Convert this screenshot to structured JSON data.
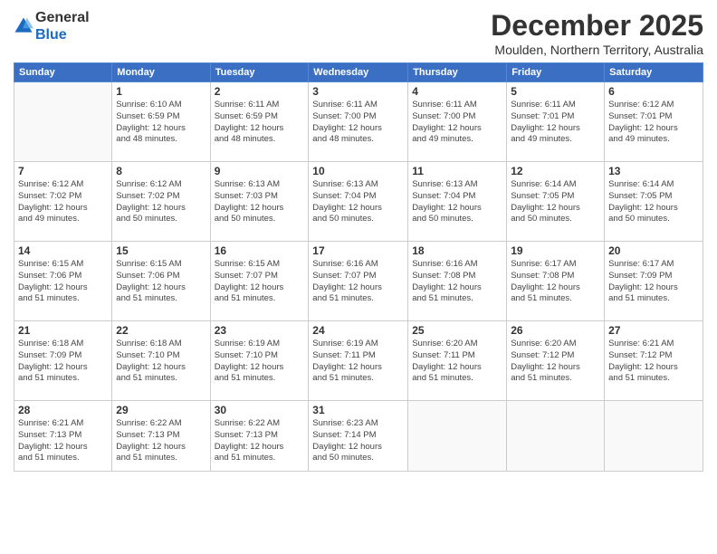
{
  "header": {
    "logo_line1": "General",
    "logo_line2": "Blue",
    "month": "December 2025",
    "location": "Moulden, Northern Territory, Australia"
  },
  "days_of_week": [
    "Sunday",
    "Monday",
    "Tuesday",
    "Wednesday",
    "Thursday",
    "Friday",
    "Saturday"
  ],
  "weeks": [
    [
      {
        "day": "",
        "detail": ""
      },
      {
        "day": "1",
        "detail": "Sunrise: 6:10 AM\nSunset: 6:59 PM\nDaylight: 12 hours\nand 48 minutes."
      },
      {
        "day": "2",
        "detail": "Sunrise: 6:11 AM\nSunset: 6:59 PM\nDaylight: 12 hours\nand 48 minutes."
      },
      {
        "day": "3",
        "detail": "Sunrise: 6:11 AM\nSunset: 7:00 PM\nDaylight: 12 hours\nand 48 minutes."
      },
      {
        "day": "4",
        "detail": "Sunrise: 6:11 AM\nSunset: 7:00 PM\nDaylight: 12 hours\nand 49 minutes."
      },
      {
        "day": "5",
        "detail": "Sunrise: 6:11 AM\nSunset: 7:01 PM\nDaylight: 12 hours\nand 49 minutes."
      },
      {
        "day": "6",
        "detail": "Sunrise: 6:12 AM\nSunset: 7:01 PM\nDaylight: 12 hours\nand 49 minutes."
      }
    ],
    [
      {
        "day": "7",
        "detail": "Sunrise: 6:12 AM\nSunset: 7:02 PM\nDaylight: 12 hours\nand 49 minutes."
      },
      {
        "day": "8",
        "detail": "Sunrise: 6:12 AM\nSunset: 7:02 PM\nDaylight: 12 hours\nand 50 minutes."
      },
      {
        "day": "9",
        "detail": "Sunrise: 6:13 AM\nSunset: 7:03 PM\nDaylight: 12 hours\nand 50 minutes."
      },
      {
        "day": "10",
        "detail": "Sunrise: 6:13 AM\nSunset: 7:04 PM\nDaylight: 12 hours\nand 50 minutes."
      },
      {
        "day": "11",
        "detail": "Sunrise: 6:13 AM\nSunset: 7:04 PM\nDaylight: 12 hours\nand 50 minutes."
      },
      {
        "day": "12",
        "detail": "Sunrise: 6:14 AM\nSunset: 7:05 PM\nDaylight: 12 hours\nand 50 minutes."
      },
      {
        "day": "13",
        "detail": "Sunrise: 6:14 AM\nSunset: 7:05 PM\nDaylight: 12 hours\nand 50 minutes."
      }
    ],
    [
      {
        "day": "14",
        "detail": "Sunrise: 6:15 AM\nSunset: 7:06 PM\nDaylight: 12 hours\nand 51 minutes."
      },
      {
        "day": "15",
        "detail": "Sunrise: 6:15 AM\nSunset: 7:06 PM\nDaylight: 12 hours\nand 51 minutes."
      },
      {
        "day": "16",
        "detail": "Sunrise: 6:15 AM\nSunset: 7:07 PM\nDaylight: 12 hours\nand 51 minutes."
      },
      {
        "day": "17",
        "detail": "Sunrise: 6:16 AM\nSunset: 7:07 PM\nDaylight: 12 hours\nand 51 minutes."
      },
      {
        "day": "18",
        "detail": "Sunrise: 6:16 AM\nSunset: 7:08 PM\nDaylight: 12 hours\nand 51 minutes."
      },
      {
        "day": "19",
        "detail": "Sunrise: 6:17 AM\nSunset: 7:08 PM\nDaylight: 12 hours\nand 51 minutes."
      },
      {
        "day": "20",
        "detail": "Sunrise: 6:17 AM\nSunset: 7:09 PM\nDaylight: 12 hours\nand 51 minutes."
      }
    ],
    [
      {
        "day": "21",
        "detail": "Sunrise: 6:18 AM\nSunset: 7:09 PM\nDaylight: 12 hours\nand 51 minutes."
      },
      {
        "day": "22",
        "detail": "Sunrise: 6:18 AM\nSunset: 7:10 PM\nDaylight: 12 hours\nand 51 minutes."
      },
      {
        "day": "23",
        "detail": "Sunrise: 6:19 AM\nSunset: 7:10 PM\nDaylight: 12 hours\nand 51 minutes."
      },
      {
        "day": "24",
        "detail": "Sunrise: 6:19 AM\nSunset: 7:11 PM\nDaylight: 12 hours\nand 51 minutes."
      },
      {
        "day": "25",
        "detail": "Sunrise: 6:20 AM\nSunset: 7:11 PM\nDaylight: 12 hours\nand 51 minutes."
      },
      {
        "day": "26",
        "detail": "Sunrise: 6:20 AM\nSunset: 7:12 PM\nDaylight: 12 hours\nand 51 minutes."
      },
      {
        "day": "27",
        "detail": "Sunrise: 6:21 AM\nSunset: 7:12 PM\nDaylight: 12 hours\nand 51 minutes."
      }
    ],
    [
      {
        "day": "28",
        "detail": "Sunrise: 6:21 AM\nSunset: 7:13 PM\nDaylight: 12 hours\nand 51 minutes."
      },
      {
        "day": "29",
        "detail": "Sunrise: 6:22 AM\nSunset: 7:13 PM\nDaylight: 12 hours\nand 51 minutes."
      },
      {
        "day": "30",
        "detail": "Sunrise: 6:22 AM\nSunset: 7:13 PM\nDaylight: 12 hours\nand 51 minutes."
      },
      {
        "day": "31",
        "detail": "Sunrise: 6:23 AM\nSunset: 7:14 PM\nDaylight: 12 hours\nand 50 minutes."
      },
      {
        "day": "",
        "detail": ""
      },
      {
        "day": "",
        "detail": ""
      },
      {
        "day": "",
        "detail": ""
      }
    ]
  ]
}
